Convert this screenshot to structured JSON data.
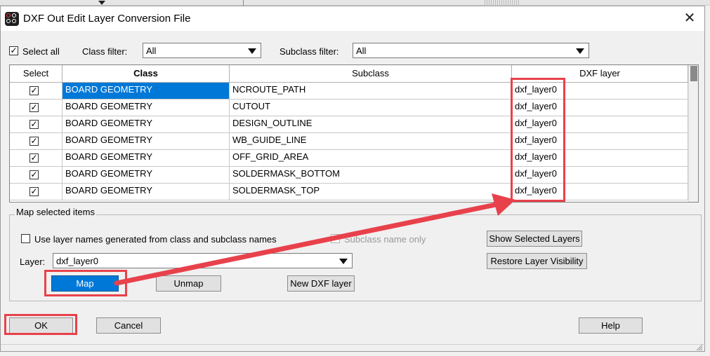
{
  "dialog": {
    "title": "DXF Out Edit Layer Conversion File",
    "close_glyph": "✕"
  },
  "filters": {
    "select_all_label": "Select all",
    "select_all_checked": true,
    "class_filter_label": "Class filter:",
    "class_filter_value": "All",
    "subclass_filter_label": "Subclass filter:",
    "subclass_filter_value": "All"
  },
  "table": {
    "headers": [
      "Select",
      "Class",
      "Subclass",
      "DXF layer"
    ],
    "rows": [
      {
        "checked": true,
        "class": "BOARD GEOMETRY",
        "subclass": "NCROUTE_PATH",
        "layer": "dxf_layer0"
      },
      {
        "checked": true,
        "class": "BOARD GEOMETRY",
        "subclass": "CUTOUT",
        "layer": "dxf_layer0"
      },
      {
        "checked": true,
        "class": "BOARD GEOMETRY",
        "subclass": "DESIGN_OUTLINE",
        "layer": "dxf_layer0"
      },
      {
        "checked": true,
        "class": "BOARD GEOMETRY",
        "subclass": "WB_GUIDE_LINE",
        "layer": "dxf_layer0"
      },
      {
        "checked": true,
        "class": "BOARD GEOMETRY",
        "subclass": "OFF_GRID_AREA",
        "layer": "dxf_layer0"
      },
      {
        "checked": true,
        "class": "BOARD GEOMETRY",
        "subclass": "SOLDERMASK_BOTTOM",
        "layer": "dxf_layer0"
      },
      {
        "checked": true,
        "class": "BOARD GEOMETRY",
        "subclass": "SOLDERMASK_TOP",
        "layer": "dxf_layer0"
      }
    ],
    "check_glyph": "✓"
  },
  "map_group": {
    "legend": "Map selected items",
    "use_layer_names_label": "Use layer names generated from class and subclass names",
    "subclass_only_label": "Subclass name only",
    "layer_label": "Layer:",
    "layer_value": "dxf_layer0",
    "map_button": "Map",
    "unmap_button": "Unmap",
    "new_dxf_layer_button": "New DXF layer",
    "show_selected_button": "Show Selected Layers",
    "restore_visibility_button": "Restore Layer Visibility"
  },
  "footer": {
    "ok_button": "OK",
    "cancel_button": "Cancel",
    "help_button": "Help"
  },
  "colors": {
    "accent": "#0078d7",
    "annotation": "#e8414b"
  }
}
